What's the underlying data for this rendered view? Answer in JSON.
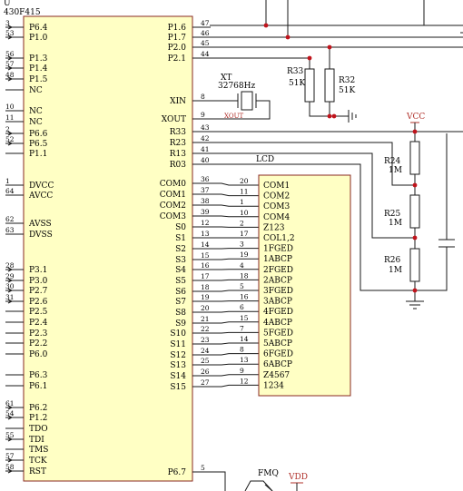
{
  "mcu": {
    "ref": "U",
    "part": "430F415",
    "left_pins": [
      {
        "num": "3",
        "label": "P6.4"
      },
      {
        "num": "53",
        "label": "P1.0"
      },
      {
        "num": "56",
        "label": "P1.3"
      },
      {
        "num": "57",
        "label": "P1.4"
      },
      {
        "num": "48",
        "label": "P1.5"
      },
      {
        "num": "",
        "label": "NC"
      },
      {
        "num": "10",
        "label": "NC"
      },
      {
        "num": "11",
        "label": "NC"
      },
      {
        "num": "2",
        "label": "P6.6"
      },
      {
        "num": "52",
        "label": "P6.5"
      },
      {
        "num": "",
        "label": "P1.1"
      },
      {
        "num": "1",
        "label": "DVCC"
      },
      {
        "num": "64",
        "label": "AVCC"
      },
      {
        "num": "62",
        "label": "AVSS"
      },
      {
        "num": "63",
        "label": "DVSS"
      },
      {
        "num": "28",
        "label": "P3.1"
      },
      {
        "num": "29",
        "label": "P3.0"
      },
      {
        "num": "30",
        "label": "P2.7"
      },
      {
        "num": "31",
        "label": "P2.6"
      },
      {
        "num": "",
        "label": "P2.5"
      },
      {
        "num": "",
        "label": "P2.4"
      },
      {
        "num": "",
        "label": "P2.3"
      },
      {
        "num": "",
        "label": "P2.2"
      },
      {
        "num": "",
        "label": "P6.0"
      },
      {
        "num": "",
        "label": "P6.3"
      },
      {
        "num": "",
        "label": "P6.1"
      },
      {
        "num": "61",
        "label": "P6.2"
      },
      {
        "num": "54",
        "label": "P1.2"
      },
      {
        "num": "",
        "label": "TDO"
      },
      {
        "num": "55",
        "label": "TDI"
      },
      {
        "num": "",
        "label": "TMS"
      },
      {
        "num": "57",
        "label": "TCK"
      },
      {
        "num": "58",
        "label": "RST"
      }
    ],
    "right_pins": [
      {
        "num": "47",
        "label": "P1.6"
      },
      {
        "num": "46",
        "label": "P1.7"
      },
      {
        "num": "45",
        "label": "P2.0"
      },
      {
        "num": "44",
        "label": "P2.1"
      },
      {
        "num": "8",
        "label": "XIN"
      },
      {
        "num": "9",
        "label": "XOUT"
      },
      {
        "num": "43",
        "label": "R33"
      },
      {
        "num": "42",
        "label": "R23"
      },
      {
        "num": "41",
        "label": "R13"
      },
      {
        "num": "40",
        "label": "R03"
      },
      {
        "num": "36",
        "label": "COM0"
      },
      {
        "num": "37",
        "label": "COM1"
      },
      {
        "num": "38",
        "label": "COM2"
      },
      {
        "num": "39",
        "label": "COM3"
      },
      {
        "num": "12",
        "label": "S0"
      },
      {
        "num": "13",
        "label": "S1"
      },
      {
        "num": "14",
        "label": "S2"
      },
      {
        "num": "15",
        "label": "S3"
      },
      {
        "num": "16",
        "label": "S4"
      },
      {
        "num": "17",
        "label": "S5"
      },
      {
        "num": "18",
        "label": "S6"
      },
      {
        "num": "19",
        "label": "S7"
      },
      {
        "num": "20",
        "label": "S8"
      },
      {
        "num": "21",
        "label": "S9"
      },
      {
        "num": "22",
        "label": "S10"
      },
      {
        "num": "23",
        "label": "S11"
      },
      {
        "num": "24",
        "label": "S12"
      },
      {
        "num": "25",
        "label": "S13"
      },
      {
        "num": "26",
        "label": "S14"
      },
      {
        "num": "27",
        "label": "S15"
      },
      {
        "num": "5",
        "label": "P6.7"
      }
    ]
  },
  "lcd": {
    "title": "LCD",
    "pins": [
      {
        "num": "20",
        "label": "COM1"
      },
      {
        "num": "11",
        "label": "COM2"
      },
      {
        "num": "1",
        "label": "COM3"
      },
      {
        "num": "10",
        "label": "COM4"
      },
      {
        "num": "2",
        "label": "Z123"
      },
      {
        "num": "17",
        "label": "COL1,2"
      },
      {
        "num": "3",
        "label": "1FGED"
      },
      {
        "num": "19",
        "label": "1ABCP"
      },
      {
        "num": "4",
        "label": "2FGED"
      },
      {
        "num": "18",
        "label": "2ABCP"
      },
      {
        "num": "5",
        "label": "3FGED"
      },
      {
        "num": "16",
        "label": "3ABCP"
      },
      {
        "num": "6",
        "label": "4FGED"
      },
      {
        "num": "15",
        "label": "4ABCP"
      },
      {
        "num": "7",
        "label": "5FGED"
      },
      {
        "num": "14",
        "label": "5ABCP"
      },
      {
        "num": "8",
        "label": "6FGED"
      },
      {
        "num": "13",
        "label": "6ABCP"
      },
      {
        "num": "9",
        "label": "Z4567"
      },
      {
        "num": "12",
        "label": "1234"
      }
    ]
  },
  "crystal": {
    "ref": "XT",
    "value": "32768Hz",
    "net": "XOUT"
  },
  "pullups": [
    {
      "ref": "R33",
      "value": "51K"
    },
    {
      "ref": "R32",
      "value": "51K"
    }
  ],
  "ladder": [
    {
      "ref": "R24",
      "value": "1M"
    },
    {
      "ref": "R25",
      "value": "1M"
    },
    {
      "ref": "R26",
      "value": "1M"
    }
  ],
  "vcc_label": "VCC",
  "buzzer": {
    "ref": "FMQ",
    "supply": "VDD"
  },
  "colors": {
    "chip_fill": "#ffffc4",
    "chip_border": "#8a2a20",
    "wire": "#1a1a1a",
    "junction": "#c0141c",
    "label_red": "#b0302a"
  }
}
